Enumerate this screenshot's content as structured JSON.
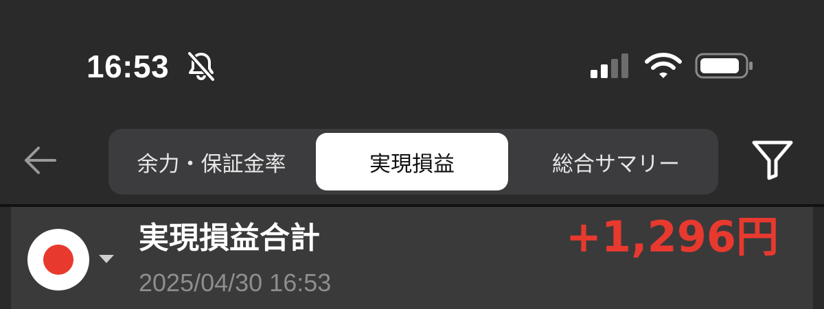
{
  "status_bar": {
    "time": "16:53",
    "icons": [
      "bell-off-icon",
      "cellular-signal-icon",
      "wifi-icon",
      "battery-icon"
    ]
  },
  "nav": {
    "back_icon": "arrow-left-icon",
    "filter_icon": "filter-icon",
    "tabs": [
      {
        "label": "余力・保証金率",
        "selected": false
      },
      {
        "label": "実現損益",
        "selected": true
      },
      {
        "label": "総合サマリー",
        "selected": false
      }
    ]
  },
  "summary": {
    "title": "実現損益合計",
    "datetime": "2025/04/30 16:53",
    "amount": "+1,296円",
    "market_icon": "japan-flag-icon"
  },
  "colors": {
    "background": "#2a2a2a",
    "row_background": "#3a3a3a",
    "segment_background": "#3c3c3e",
    "selected_tab": "#ffffff",
    "profit_red": "#e8392f",
    "muted_text": "#8e8e8e"
  }
}
